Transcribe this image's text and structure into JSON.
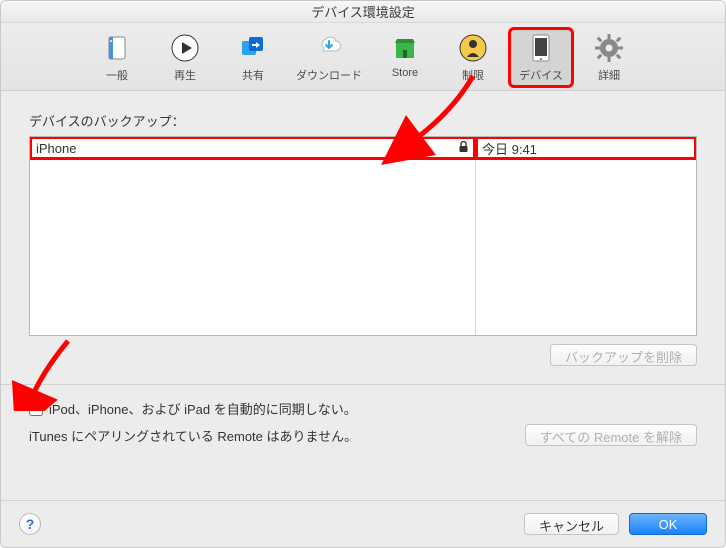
{
  "window": {
    "title": "デバイス環境設定"
  },
  "toolbar": {
    "items": [
      {
        "label": "一般"
      },
      {
        "label": "再生"
      },
      {
        "label": "共有"
      },
      {
        "label": "ダウンロード"
      },
      {
        "label": "Store"
      },
      {
        "label": "制限"
      },
      {
        "label": "デバイス"
      },
      {
        "label": "詳細"
      }
    ]
  },
  "section": {
    "backup_label": "デバイスのバックアップ："
  },
  "backup": {
    "rows": [
      {
        "name": "iPhone",
        "time": "今日 9:41",
        "locked": true
      }
    ]
  },
  "buttons": {
    "delete_backup": "バックアップを削除",
    "release_remotes": "すべての Remote を解除",
    "cancel": "キャンセル",
    "ok": "OK"
  },
  "options": {
    "no_autosync_label": "iPod、iPhone、および iPad を自動的に同期しない。",
    "no_autosync_checked": false
  },
  "status": {
    "remote_text": "iTunes にペアリングされている Remote はありません。"
  },
  "help": {
    "symbol": "?"
  }
}
